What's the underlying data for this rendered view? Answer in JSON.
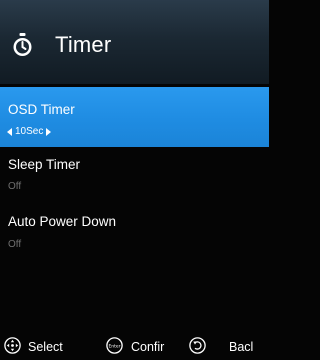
{
  "header": {
    "title": "Timer",
    "icon": "stopwatch-icon"
  },
  "menu": {
    "items": [
      {
        "label": "OSD Timer",
        "value": "10Sec",
        "selected": true
      },
      {
        "label": "Sleep Timer",
        "value": "Off",
        "selected": false
      },
      {
        "label": "Auto Power Down",
        "value": "Off",
        "selected": false
      }
    ]
  },
  "footer": {
    "select": {
      "label": "Select",
      "icon": "dpad-icon"
    },
    "confirm": {
      "label": "Confir",
      "icon": "enter-button-icon",
      "icon_text": "Enter"
    },
    "back": {
      "label": "Bacl",
      "icon": "back-arrow-icon"
    }
  },
  "colors": {
    "highlight": "#2a99ee",
    "header_bg": "#1b2833",
    "value_text": "#6f6f6f",
    "background": "#050505"
  }
}
